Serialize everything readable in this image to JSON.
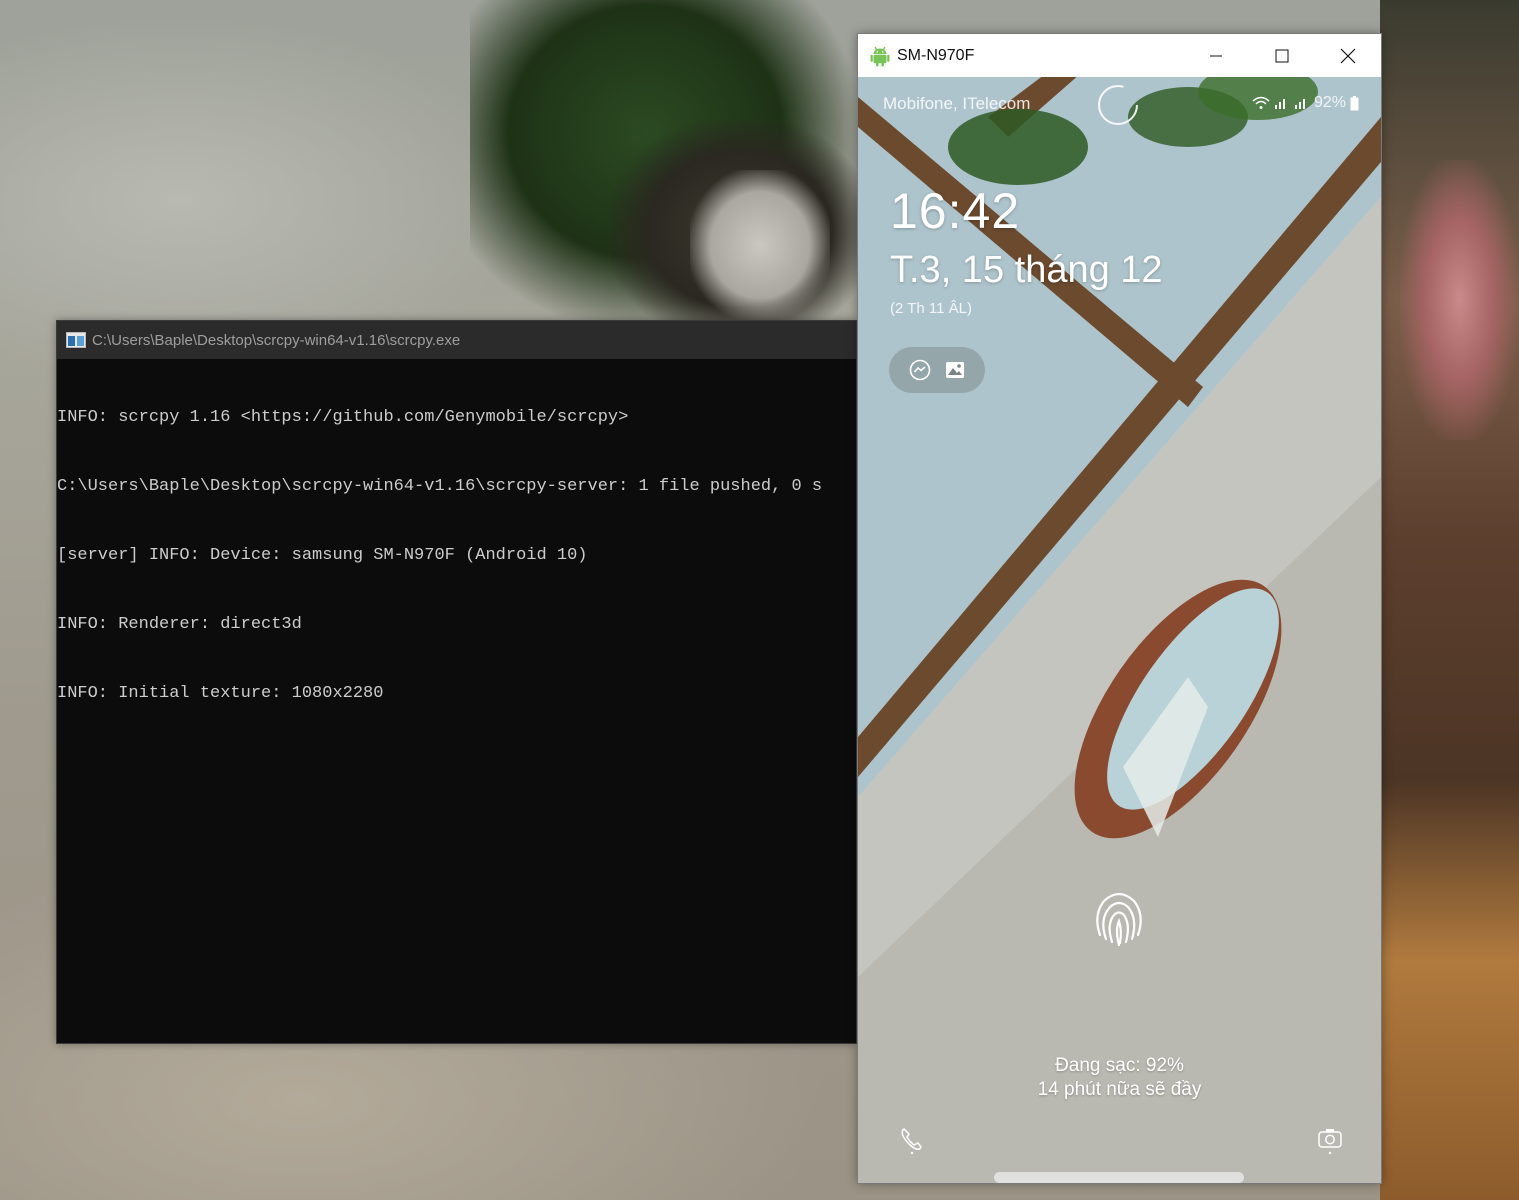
{
  "console": {
    "title": "C:\\Users\\Baple\\Desktop\\scrcpy-win64-v1.16\\scrcpy.exe",
    "lines": [
      "INFO: scrcpy 1.16 <https://github.com/Genymobile/scrcpy>",
      "C:\\Users\\Baple\\Desktop\\scrcpy-win64-v1.16\\scrcpy-server: 1 file pushed, 0 s",
      "[server] INFO: Device: samsung SM-N970F (Android 10)",
      "INFO: Renderer: direct3d",
      "INFO: Initial texture: 1080x2280"
    ]
  },
  "scrcpy": {
    "title": "SM-N970F",
    "controls": {
      "minimize": "minimize-icon",
      "maximize": "maximize-icon",
      "close": "close-icon"
    }
  },
  "phone": {
    "carrier": "Mobifone, ITelecom",
    "battery": "92%",
    "time": "16:42",
    "date": "T.3, 15 tháng 12",
    "lunar": "(2 Th 11 ÂL)",
    "notifications": [
      "messenger-icon",
      "gallery-icon"
    ],
    "charging_status": "Đang sạc: 92%",
    "charging_eta": "14 phút nữa sẽ đầy",
    "shortcuts": {
      "left": "phone-icon",
      "right": "camera-icon"
    }
  },
  "colors": {
    "console_bg": "#0c0c0c",
    "console_text": "#cccccc",
    "android_green": "#78c257"
  }
}
